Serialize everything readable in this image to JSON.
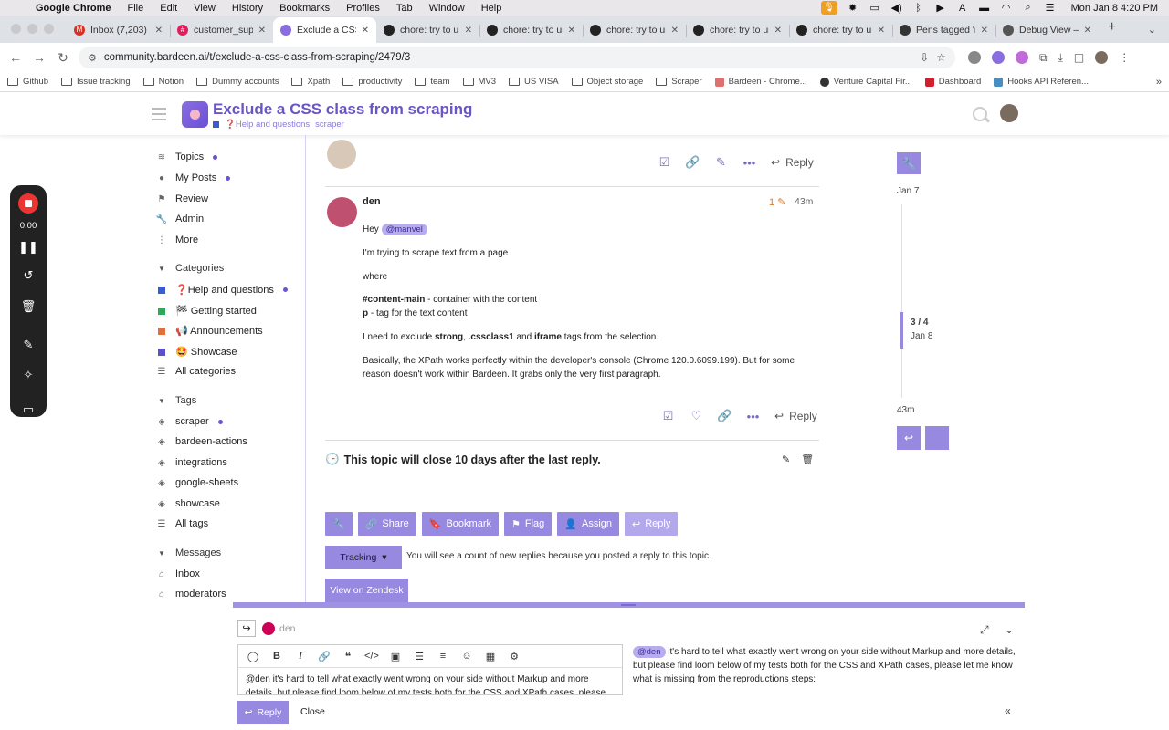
{
  "menubar": {
    "items": [
      "Google Chrome",
      "File",
      "Edit",
      "View",
      "History",
      "Bookmarks",
      "Profiles",
      "Tab",
      "Window",
      "Help"
    ],
    "clock": "Mon Jan 8  4:20 PM"
  },
  "tabs": [
    {
      "title": "Inbox (7,203) -",
      "active": false
    },
    {
      "title": "customer_supp",
      "active": false
    },
    {
      "title": "Exclude a CSS",
      "active": true
    },
    {
      "title": "chore: try to un",
      "active": false
    },
    {
      "title": "chore: try to un",
      "active": false
    },
    {
      "title": "chore: try to un",
      "active": false
    },
    {
      "title": "chore: try to un",
      "active": false
    },
    {
      "title": "chore: try to un",
      "active": false
    },
    {
      "title": "Pens tagged 'n",
      "active": false
    },
    {
      "title": "Debug View – C",
      "active": false
    }
  ],
  "address": {
    "url": "community.bardeen.ai/t/exclude-a-css-class-from-scraping/2479/3"
  },
  "bookmarks": [
    "Github",
    "Issue tracking",
    "Notion",
    "Dummy accounts",
    "Xpath",
    "productivity",
    "team",
    "MV3",
    "US VISA",
    "Object storage",
    "Scraper",
    "Bardeen - Chrome...",
    "Venture Capital Fir...",
    "Dashboard",
    "Hooks API Referen..."
  ],
  "topic": {
    "title": "Exclude a CSS class from scraping",
    "category": "❓Help and questions",
    "tag": "scraper"
  },
  "recorder": {
    "time": "0:00"
  },
  "sidebar": {
    "nav": [
      "Topics",
      "My Posts",
      "Review",
      "Admin",
      "More"
    ],
    "categories_heading": "Categories",
    "categories": [
      {
        "label": "❓Help and questions",
        "color": "#3b5bd0"
      },
      {
        "label": "🏁 Getting started",
        "color": "#2fa85a"
      },
      {
        "label": "📢 Announcements",
        "color": "#e0703a"
      },
      {
        "label": "🤩 Showcase",
        "color": "#5a52c8"
      },
      {
        "label": "All categories",
        "color": ""
      }
    ],
    "tags_heading": "Tags",
    "tags": [
      "scraper",
      "bardeen-actions",
      "integrations",
      "google-sheets",
      "showcase",
      "All tags"
    ],
    "messages_heading": "Messages",
    "messages": [
      "Inbox",
      "moderators"
    ]
  },
  "post": {
    "reply_label": "Reply",
    "author": "den",
    "edit_count": "1",
    "age": "43m",
    "greeting": "Hey",
    "mention": "@manvel",
    "p1": "I'm trying to scrape text from a page",
    "p2": "where",
    "l1_bold": "#content-main",
    "l1_rest": " - container with the content",
    "l2_bold": "p",
    "l2_rest": " - tag for the text content",
    "p3_a": "I need to exclude ",
    "p3_b1": "strong",
    "p3_c": ", ",
    "p3_b2": ".cssclass1",
    "p3_d": " and ",
    "p3_b3": "iframe",
    "p3_e": " tags from the selection.",
    "p4_line1": "Basically, the XPath works perfectly within the developer's console (Chrome 120.0.6099.199). But for some",
    "p4_line2": "reason doesn't work within Bardeen. It grabs only the very first paragraph."
  },
  "close_notice": "This topic will close 10 days after the last reply.",
  "footer_buttons": [
    "Share",
    "Bookmark",
    "Flag",
    "Assign",
    "Reply"
  ],
  "tracking": {
    "label": "Tracking",
    "message": "You will see a count of new replies because you posted a reply to this topic."
  },
  "zendesk_label": "View on Zendesk",
  "timeline": {
    "start": "Jan 7",
    "position": "3 / 4",
    "position_date": "Jan 8",
    "end": "43m"
  },
  "composer": {
    "to_user": "den",
    "editor_line1": "@den it's hard to tell what exactly went wrong on your side without Markup and more",
    "editor_line2": "details, but please find loom below of my tests both for the CSS and XPath cases, please let",
    "preview_mention": "@den",
    "preview_text": " it's hard to tell what exactly went wrong on your side without Markup and more details, but please find loom below of my tests both for the CSS and XPath cases, please let me know what is missing from the reproductions steps:",
    "reply_label": "Reply",
    "close_label": "Close"
  },
  "colors": {
    "accent": "#9788e0",
    "title": "#6a55c6",
    "mention_bg": "#b8acef"
  }
}
